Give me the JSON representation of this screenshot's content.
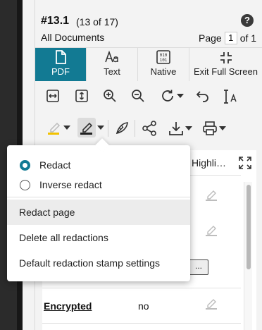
{
  "header": {
    "doc_number": "#13.1",
    "doc_count": "(13 of 17)",
    "help_label": "?",
    "collection": "All Documents",
    "page_label": "Page",
    "page_value": "1",
    "page_of": "of 1"
  },
  "tabs": [
    {
      "label": "PDF",
      "icon": "file-icon",
      "active": true
    },
    {
      "label": "Text",
      "icon": "text-aa-icon",
      "active": false
    },
    {
      "label": "Native",
      "icon": "binary-file-icon",
      "active": false
    },
    {
      "label": "Exit Full Screen",
      "icon": "exit-fullscreen-icon",
      "active": false
    }
  ],
  "content": {
    "column_header": "Highli…",
    "more_button": "...",
    "field_name": "Encrypted",
    "field_value": "no"
  },
  "redact_menu": {
    "mode_options": [
      {
        "label": "Redact",
        "checked": true
      },
      {
        "label": "Inverse redact",
        "checked": false
      }
    ],
    "items": [
      {
        "label": "Redact page",
        "hover": true
      },
      {
        "label": "Delete all redactions",
        "hover": false
      },
      {
        "label": "Default redaction stamp settings",
        "hover": false
      }
    ]
  },
  "colors": {
    "accent": "#127a93",
    "highlight_underline": "#f2c200",
    "pen_gray": "#bdbdbd"
  }
}
